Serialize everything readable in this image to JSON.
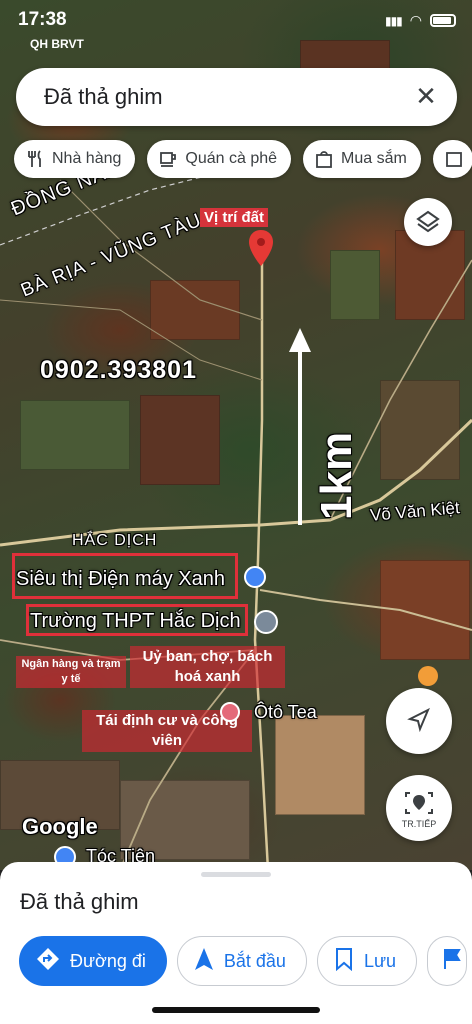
{
  "status_bar": {
    "time": "17:38",
    "carrier": "QH BRVT"
  },
  "search": {
    "query": "Đã thả ghim",
    "clear_icon": "close-icon"
  },
  "chips": [
    {
      "label": "Nhà hàng",
      "icon": "fork-knife-icon"
    },
    {
      "label": "Quán cà phê",
      "icon": "coffee-cup-icon"
    },
    {
      "label": "Mua sắm",
      "icon": "shopping-bag-icon"
    }
  ],
  "map": {
    "labels": {
      "province_1": "ĐỒNG NAI",
      "province_2": "BÀ RỊA - VŨNG TÀU",
      "pin_label": "Vị trí đất",
      "phone": "0902.393801",
      "distance": "1km",
      "road": "Võ Văn Kiệt",
      "area": "HẮC DỊCH",
      "store": "Siêu thị Điện máy Xanh",
      "school": "Trường THPT Hắc Dịch",
      "bank": "Ngân hàng và trạm y tế",
      "committee": "Uỷ ban, chợ, bách hoá xanh",
      "resettlement": "Tái định cư và công viên",
      "poi_tea": "Ôtô Tea",
      "town": "Tóc Tiên",
      "logo": "Google",
      "next_label": "TR.TIẾP"
    },
    "colors": {
      "red_overlay": "#e0303a",
      "pin": "#e53935",
      "accent": "#1a73e8"
    }
  },
  "sheet": {
    "title": "Đã thả ghim",
    "actions": [
      {
        "label": "Đường đi",
        "icon": "directions-icon"
      },
      {
        "label": "Bắt đầu",
        "icon": "navigation-arrow-icon"
      },
      {
        "label": "Lưu",
        "icon": "bookmark-icon"
      }
    ]
  }
}
